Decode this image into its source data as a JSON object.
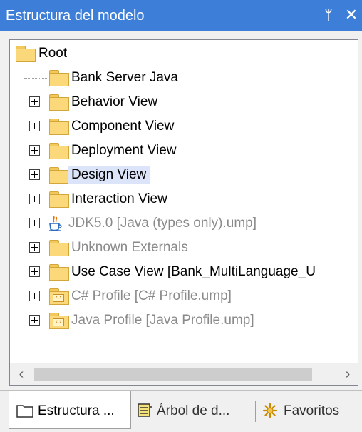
{
  "panel": {
    "title": "Estructura del modelo",
    "pin_glyph": "ᛘ",
    "close_glyph": "✕"
  },
  "tree": {
    "root_label": "Root",
    "items": [
      {
        "label": "Bank Server Java",
        "icon": "folder-icon",
        "expandable": false,
        "grey": false
      },
      {
        "label": "Behavior View",
        "icon": "folder-icon",
        "expandable": true,
        "grey": false
      },
      {
        "label": "Component View",
        "icon": "folder-icon",
        "expandable": true,
        "grey": false
      },
      {
        "label": "Deployment View",
        "icon": "folder-icon",
        "expandable": true,
        "grey": false
      },
      {
        "label": "Design View",
        "icon": "folder-icon",
        "expandable": true,
        "grey": false,
        "selected": true
      },
      {
        "label": "Interaction View",
        "icon": "folder-icon",
        "expandable": true,
        "grey": false
      },
      {
        "label": "JDK5.0 [Java (types only).ump]",
        "icon": "java-icon",
        "expandable": true,
        "grey": true
      },
      {
        "label": "Unknown Externals",
        "icon": "folder-icon",
        "expandable": true,
        "grey": true
      },
      {
        "label": "Use Case View [Bank_MultiLanguage_U",
        "icon": "folder-icon",
        "expandable": true,
        "grey": false
      },
      {
        "label": "C# Profile [C# Profile.ump]",
        "icon": "profile-folder-icon",
        "expandable": true,
        "grey": true
      },
      {
        "label": "Java Profile [Java Profile.ump]",
        "icon": "profile-folder-icon",
        "expandable": true,
        "grey": true
      }
    ]
  },
  "scrollbar": {
    "left_glyph": "‹",
    "right_glyph": "›"
  },
  "tabs": [
    {
      "label": "Estructura ...",
      "icon": "folder-outline-icon",
      "active": true
    },
    {
      "label": "Árbol de d...",
      "icon": "diagram-tree-icon",
      "active": false
    },
    {
      "label": "Favoritos",
      "icon": "star-icon",
      "active": false
    }
  ],
  "colors": {
    "title_bar": "#3d7fd8",
    "selection": "#dbe4f8",
    "folder": "#fbd97a",
    "grey_text": "#8a8a8a"
  }
}
